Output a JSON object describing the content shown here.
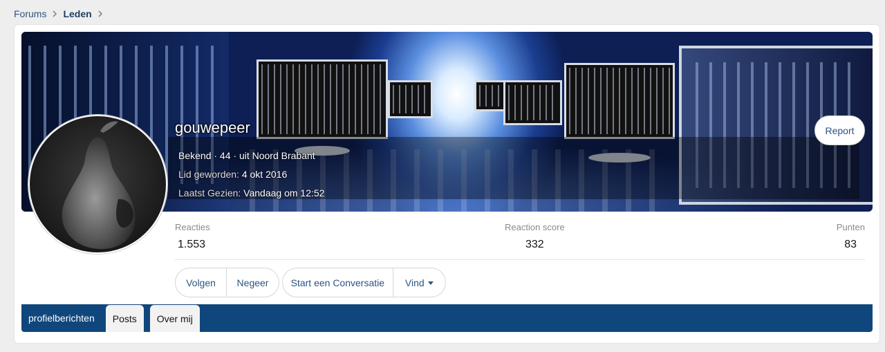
{
  "breadcrumb": {
    "items": [
      {
        "label": "Forums"
      },
      {
        "label": "Leden"
      }
    ]
  },
  "profile": {
    "username": "gouwepeer",
    "title_line": "Bekend · 44 · uit Noord Brabant",
    "joined_label": "Lid geworden:",
    "joined_value": "4 okt 2016",
    "last_seen_label": "Laatst Gezien:",
    "last_seen_value": "Vandaag om 12:52",
    "report_label": "Report"
  },
  "stats": {
    "reactions_label": "Reacties",
    "reactions_value": "1.553",
    "score_label": "Reaction score",
    "score_value": "332",
    "points_label": "Punten",
    "points_value": "83"
  },
  "actions": {
    "follow": "Volgen",
    "ignore": "Negeer",
    "conversation": "Start een Conversatie",
    "find": "Vind"
  },
  "tabs": [
    {
      "label": "profielberichten"
    },
    {
      "label": "Posts"
    },
    {
      "label": "Over mij"
    }
  ],
  "colors": {
    "link": "#2b5480",
    "tab_bar": "#0f477d",
    "page_bg": "#eeeeee"
  }
}
